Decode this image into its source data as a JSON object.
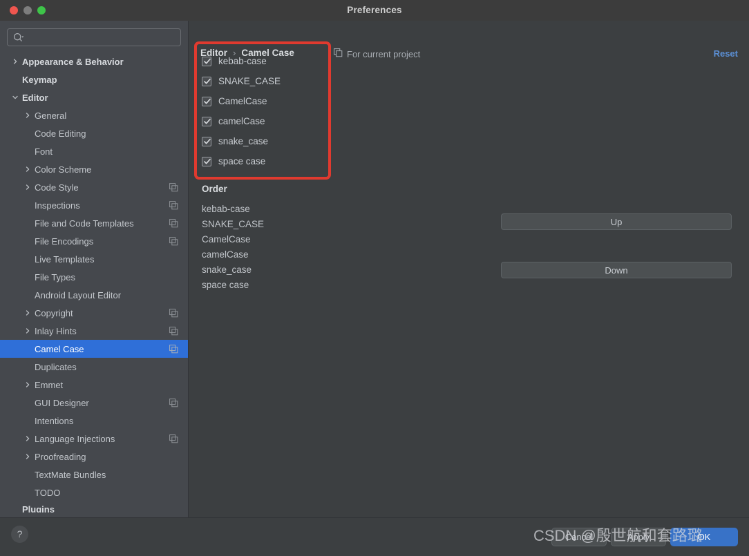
{
  "window": {
    "title": "Preferences",
    "traffic_lights": [
      "close-red",
      "minimize-gray",
      "zoom-green"
    ]
  },
  "sidebar": {
    "search": {
      "value": "",
      "placeholder": ""
    },
    "items": [
      {
        "label": "Appearance & Behavior",
        "indent": 0,
        "arrow": "right",
        "bold": true,
        "page_icon": false,
        "selected": false
      },
      {
        "label": "Keymap",
        "indent": 0,
        "arrow": "none",
        "bold": true,
        "page_icon": false,
        "selected": false
      },
      {
        "label": "Editor",
        "indent": 0,
        "arrow": "down",
        "bold": true,
        "page_icon": false,
        "selected": false
      },
      {
        "label": "General",
        "indent": 1,
        "arrow": "right",
        "bold": false,
        "page_icon": false,
        "selected": false
      },
      {
        "label": "Code Editing",
        "indent": 1,
        "arrow": "none",
        "bold": false,
        "page_icon": false,
        "selected": false
      },
      {
        "label": "Font",
        "indent": 1,
        "arrow": "none",
        "bold": false,
        "page_icon": false,
        "selected": false
      },
      {
        "label": "Color Scheme",
        "indent": 1,
        "arrow": "right",
        "bold": false,
        "page_icon": false,
        "selected": false
      },
      {
        "label": "Code Style",
        "indent": 1,
        "arrow": "right",
        "bold": false,
        "page_icon": true,
        "selected": false
      },
      {
        "label": "Inspections",
        "indent": 1,
        "arrow": "none",
        "bold": false,
        "page_icon": true,
        "selected": false
      },
      {
        "label": "File and Code Templates",
        "indent": 1,
        "arrow": "none",
        "bold": false,
        "page_icon": true,
        "selected": false
      },
      {
        "label": "File Encodings",
        "indent": 1,
        "arrow": "none",
        "bold": false,
        "page_icon": true,
        "selected": false
      },
      {
        "label": "Live Templates",
        "indent": 1,
        "arrow": "none",
        "bold": false,
        "page_icon": false,
        "selected": false
      },
      {
        "label": "File Types",
        "indent": 1,
        "arrow": "none",
        "bold": false,
        "page_icon": false,
        "selected": false
      },
      {
        "label": "Android Layout Editor",
        "indent": 1,
        "arrow": "none",
        "bold": false,
        "page_icon": false,
        "selected": false
      },
      {
        "label": "Copyright",
        "indent": 1,
        "arrow": "right",
        "bold": false,
        "page_icon": true,
        "selected": false
      },
      {
        "label": "Inlay Hints",
        "indent": 1,
        "arrow": "right",
        "bold": false,
        "page_icon": true,
        "selected": false
      },
      {
        "label": "Camel Case",
        "indent": 1,
        "arrow": "none",
        "bold": false,
        "page_icon": true,
        "selected": true
      },
      {
        "label": "Duplicates",
        "indent": 1,
        "arrow": "none",
        "bold": false,
        "page_icon": false,
        "selected": false
      },
      {
        "label": "Emmet",
        "indent": 1,
        "arrow": "right",
        "bold": false,
        "page_icon": false,
        "selected": false
      },
      {
        "label": "GUI Designer",
        "indent": 1,
        "arrow": "none",
        "bold": false,
        "page_icon": true,
        "selected": false
      },
      {
        "label": "Intentions",
        "indent": 1,
        "arrow": "none",
        "bold": false,
        "page_icon": false,
        "selected": false
      },
      {
        "label": "Language Injections",
        "indent": 1,
        "arrow": "right",
        "bold": false,
        "page_icon": true,
        "selected": false
      },
      {
        "label": "Proofreading",
        "indent": 1,
        "arrow": "right",
        "bold": false,
        "page_icon": false,
        "selected": false
      },
      {
        "label": "TextMate Bundles",
        "indent": 1,
        "arrow": "none",
        "bold": false,
        "page_icon": false,
        "selected": false
      },
      {
        "label": "TODO",
        "indent": 1,
        "arrow": "none",
        "bold": false,
        "page_icon": false,
        "selected": false
      },
      {
        "label": "Plugins",
        "indent": 0,
        "arrow": "none",
        "bold": true,
        "page_icon": false,
        "selected": false,
        "clipped": true
      }
    ]
  },
  "main": {
    "breadcrumb": {
      "parent": "Editor",
      "separator": "›",
      "current": "Camel Case"
    },
    "for_current_project": "For current project",
    "reset_label": "Reset",
    "checkboxes": [
      {
        "label": "kebab-case",
        "checked": true
      },
      {
        "label": "SNAKE_CASE",
        "checked": true
      },
      {
        "label": "CamelCase",
        "checked": true
      },
      {
        "label": "camelCase",
        "checked": true
      },
      {
        "label": "snake_case",
        "checked": true
      },
      {
        "label": "space case",
        "checked": true
      }
    ],
    "order_title": "Order",
    "order": [
      "kebab-case",
      "SNAKE_CASE",
      "CamelCase",
      "camelCase",
      "snake_case",
      "space case"
    ],
    "up_label": "Up",
    "down_label": "Down"
  },
  "footer": {
    "help_label": "?",
    "cancel_label": "Cancel",
    "apply_label": "Apply",
    "ok_label": "OK"
  },
  "overlay": {
    "watermark": "CSDN @殷世航和套路璐"
  },
  "colors": {
    "accent_selection": "#2f6fd8",
    "annotation_red": "#e03a2f",
    "link_blue": "#5b8fd4",
    "ok_button_blue": "#3872c7",
    "sidebar_bg": "#45484d",
    "panel_bg": "#3c3f41"
  }
}
